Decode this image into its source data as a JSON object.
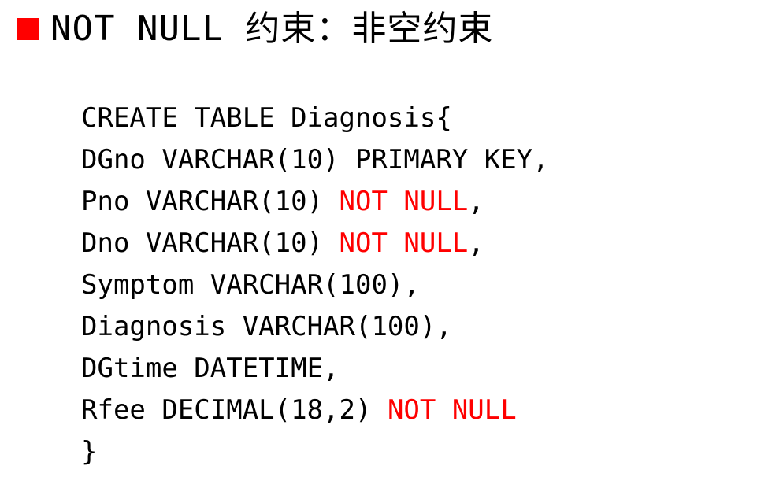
{
  "slide": {
    "bullet_color": "#ff0000",
    "title": "NOT NULL 约束：非空约束"
  },
  "code": {
    "highlight_color": "#ff0000",
    "lines": [
      {
        "text": "CREATE TABLE Diagnosis{",
        "red": "",
        "tail": ""
      },
      {
        "text": "DGno VARCHAR(10) PRIMARY KEY,",
        "red": "",
        "tail": ""
      },
      {
        "text": "Pno VARCHAR(10) ",
        "red": "NOT NULL",
        "tail": ","
      },
      {
        "text": "Dno VARCHAR(10) ",
        "red": "NOT NULL",
        "tail": ","
      },
      {
        "text": "Symptom VARCHAR(100),",
        "red": "",
        "tail": ""
      },
      {
        "text": "Diagnosis VARCHAR(100),",
        "red": "",
        "tail": ""
      },
      {
        "text": "DGtime DATETIME,",
        "red": "",
        "tail": ""
      },
      {
        "text": "Rfee DECIMAL(18,2) ",
        "red": "NOT NULL",
        "tail": ""
      },
      {
        "text": "}",
        "red": "",
        "tail": ""
      }
    ]
  }
}
